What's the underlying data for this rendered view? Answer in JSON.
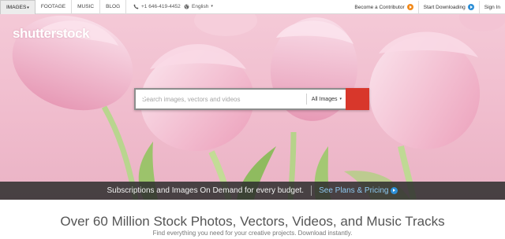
{
  "topbar": {
    "tabs": [
      {
        "label": "IMAGES",
        "active": true,
        "has_caret": true
      },
      {
        "label": "FOOTAGE"
      },
      {
        "label": "MUSIC"
      },
      {
        "label": "BLOG"
      }
    ],
    "tab_caret": "▾",
    "phone": "+1 646-419-4452",
    "language": "English",
    "language_caret": "▾",
    "contributor_label": "Become a Contributor",
    "downloading_label": "Start Downloading",
    "signin_label": "Sign In"
  },
  "hero": {
    "logo": "shutterstock",
    "search_placeholder": "Search images, vectors and videos",
    "search_value": "",
    "scope_label": "All Images",
    "scope_caret": "▾"
  },
  "promo": {
    "text": "Subscriptions and Images On Demand for every budget.",
    "link_label": "See Plans & Pricing"
  },
  "main": {
    "headline": "Over 60 Million Stock Photos, Vectors, Videos, and Music Tracks",
    "subline": "Find everything you need for your creative projects. Download instantly."
  },
  "icons": {
    "phone": "phone-icon",
    "globe": "globe-icon",
    "contributor": "arrow-circle-orange-icon",
    "downloading": "arrow-circle-blue-icon",
    "pricing": "arrow-circle-blue-icon",
    "search": "search-icon"
  },
  "colors": {
    "brand_red": "#d8372b",
    "promo_link": "#8ec8f0",
    "orange_accent": "#f28a1c",
    "blue_accent": "#2d8fd6",
    "hero_pink": "#f0bccd"
  }
}
